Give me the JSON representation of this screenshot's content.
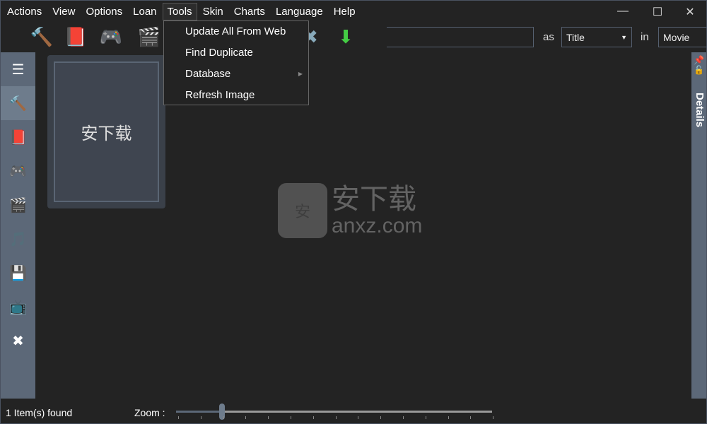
{
  "menu": [
    "Actions",
    "View",
    "Options",
    "Loan",
    "Tools",
    "Skin",
    "Charts",
    "Language",
    "Help"
  ],
  "active_menu": "Tools",
  "tools_menu": [
    "Update All From Web",
    "Find Duplicate",
    "Database",
    "Refresh Image"
  ],
  "toolbar": {
    "search_value": "",
    "as_label": "as",
    "as_value": "Title",
    "in_label": "in",
    "in_value": "Movie"
  },
  "card": {
    "title": "安下载"
  },
  "watermark": {
    "cn": "安下载",
    "url": "anxz.com",
    "badge": "安"
  },
  "details_label": "Details",
  "status": {
    "found": "1 Item(s) found",
    "zoom_label": "Zoom :",
    "zoom_value": 0.145
  },
  "colors": {
    "background": "#232323",
    "sidebar": "#5c6878"
  }
}
